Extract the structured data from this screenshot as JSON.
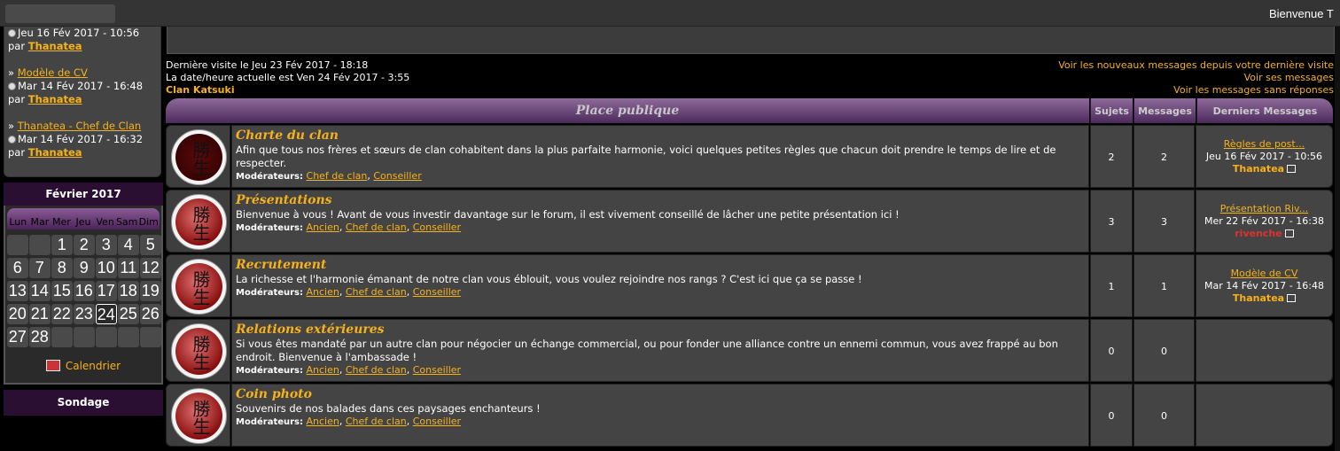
{
  "topbar": {
    "welcome": "Bienvenue T"
  },
  "recent": [
    {
      "title": "",
      "date": "Jeu 16 Fév 2017 - 10:56",
      "by_prefix": "par",
      "author": "Thanatea"
    },
    {
      "title": "Modèle de CV",
      "date": "Mar 14 Fév 2017 - 16:48",
      "by_prefix": "par",
      "author": "Thanatea"
    },
    {
      "title": "Thanatea - Chef de Clan",
      "date": "Mar 14 Fév 2017 - 16:32",
      "by_prefix": "par",
      "author": "Thanatea"
    }
  ],
  "calendar": {
    "title": "Février 2017",
    "days": [
      "Lun",
      "Mar",
      "Mer",
      "Jeu",
      "Ven",
      "Sam",
      "Dim"
    ],
    "cells": [
      "",
      "",
      "1",
      "2",
      "3",
      "4",
      "5",
      "6",
      "7",
      "8",
      "9",
      "10",
      "11",
      "12",
      "13",
      "14",
      "15",
      "16",
      "17",
      "18",
      "19",
      "20",
      "21",
      "22",
      "23",
      "24",
      "25",
      "26",
      "27",
      "28",
      "",
      "",
      "",
      "",
      ""
    ],
    "today": "24",
    "link": "Calendrier"
  },
  "sondage": "Sondage",
  "visit": {
    "last": "Dernière visite le Jeu 23 Fév 2017 - 18:18",
    "now": "La date/heure actuelle est Ven 24 Fév 2017 - 3:55",
    "clan": "Clan Katsuki"
  },
  "links": {
    "new": "Voir les nouveaux messages depuis votre dernière visite",
    "mine": "Voir ses messages",
    "unanswered": "Voir les messages sans réponses"
  },
  "header": {
    "category": "Place publique",
    "sujets": "Sujets",
    "messages": "Messages",
    "derniers": "Derniers Messages"
  },
  "mods_label": "Modérateurs:",
  "forums": [
    {
      "name": "Charte du clan",
      "desc": "Afin que tous nos frères et sœurs de clan cohabitent dans la plus parfaite harmonie, voici quelques petites règles que chacun doit prendre le temps de lire et de respecter.",
      "mods": [
        "Chef de clan",
        "Conseiller"
      ],
      "sujets": "2",
      "messages": "2",
      "last_title": "Règles de post...",
      "last_date": "Jeu 16 Fév 2017 - 10:56",
      "last_by": "Thanatea",
      "seal": "勝生"
    },
    {
      "name": "Présentations",
      "desc": "Bienvenue à vous ! Avant de vous investir davantage sur le forum, il est vivement conseillé de lâcher une petite présentation ici !",
      "mods": [
        "Ancien",
        "Chef de clan",
        "Conseiller"
      ],
      "sujets": "3",
      "messages": "3",
      "last_title": "Présentation Riv...",
      "last_date": "Mer 22 Fév 2017 - 16:38",
      "last_by": "rivenche",
      "seal": "勝生"
    },
    {
      "name": "Recrutement",
      "desc": "La richesse et l'harmonie émanant de notre clan vous éblouit, vous voulez rejoindre nos rangs ? C'est ici que ça se passe !",
      "mods": [
        "Ancien",
        "Chef de clan",
        "Conseiller"
      ],
      "sujets": "1",
      "messages": "1",
      "last_title": "Modèle de CV",
      "last_date": "Mar 14 Fév 2017 - 16:48",
      "last_by": "Thanatea",
      "seal": "勝生"
    },
    {
      "name": "Relations extérieures",
      "desc": "Si vous êtes mandaté par un autre clan pour négocier un échange commercial, ou pour fonder une alliance contre un ennemi commun, vous avez frappé au bon endroit. Bienvenue à l'ambassade !",
      "mods": [
        "Ancien",
        "Chef de clan",
        "Conseiller"
      ],
      "sujets": "0",
      "messages": "0",
      "last_title": "",
      "last_date": "",
      "last_by": "",
      "seal": "勝生"
    },
    {
      "name": "Coin photo",
      "desc": "Souvenirs de nos balades dans ces paysages enchanteurs !",
      "mods": [
        "Ancien",
        "Chef de clan",
        "Conseiller"
      ],
      "sujets": "0",
      "messages": "0",
      "last_title": "",
      "last_date": "",
      "last_by": "",
      "seal": "勝生"
    }
  ]
}
